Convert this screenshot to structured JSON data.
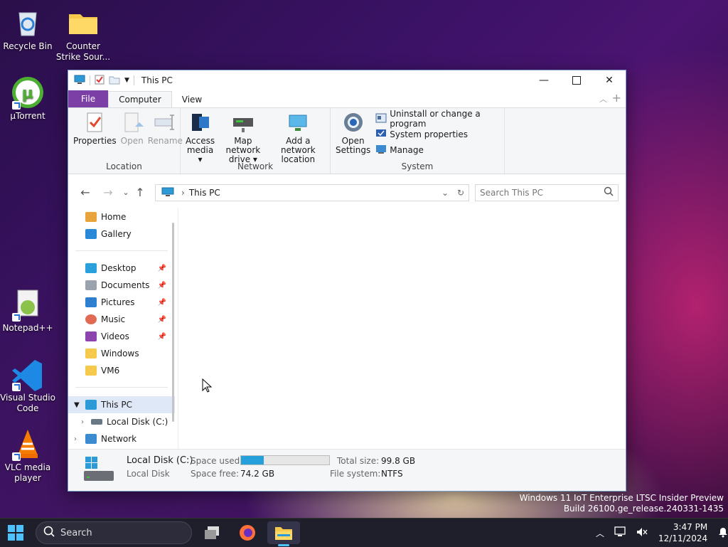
{
  "desktop": {
    "icons": [
      {
        "label": "Recycle Bin"
      },
      {
        "label": "Counter Strike Sour..."
      },
      {
        "label": "µTorrent"
      },
      {
        "label": "Notepad++"
      },
      {
        "label": "Visual Studio Code"
      },
      {
        "label": "VLC media player"
      }
    ],
    "watermark_line1": "Windows 11 IoT Enterprise LTSC Insider Preview",
    "watermark_line2": "Build 26100.ge_release.240331-1435"
  },
  "window": {
    "title": "This PC",
    "tabs": {
      "file": "File",
      "computer": "Computer",
      "view": "View"
    },
    "ribbon": {
      "location": {
        "label": "Location",
        "properties": "Properties",
        "open": "Open",
        "rename": "Rename"
      },
      "network": {
        "label": "Network",
        "access_media_1": "Access",
        "access_media_2": "media",
        "map_drive_1": "Map network",
        "map_drive_2": "drive",
        "add_location_1": "Add a network",
        "add_location_2": "location"
      },
      "system": {
        "label": "System",
        "open_settings_1": "Open",
        "open_settings_2": "Settings",
        "uninstall": "Uninstall or change a program",
        "system_properties": "System properties",
        "manage": "Manage"
      }
    },
    "address": {
      "path": "This PC",
      "search_placeholder": "Search This PC"
    },
    "nav": {
      "home": "Home",
      "gallery": "Gallery",
      "desktop": "Desktop",
      "documents": "Documents",
      "pictures": "Pictures",
      "music": "Music",
      "videos": "Videos",
      "windows": "Windows",
      "vm6": "VM6",
      "this_pc": "This PC",
      "local_disk": "Local Disk (C:)",
      "network": "Network"
    },
    "details": {
      "name": "Local Disk (C:)",
      "type": "Local Disk",
      "space_used_label": "Space used:",
      "space_free_label": "Space free:",
      "space_free": "74.2 GB",
      "total_size_label": "Total size:",
      "total_size": "99.8 GB",
      "fs_label": "File system:",
      "fs": "NTFS",
      "used_fraction": 0.256
    }
  },
  "taskbar": {
    "search": "Search",
    "time": "3:47 PM",
    "date": "12/11/2024"
  },
  "colors": {
    "file_tab": "#7b3fa6",
    "bar_fill": "#26a0da",
    "accent": "#0078d4"
  }
}
